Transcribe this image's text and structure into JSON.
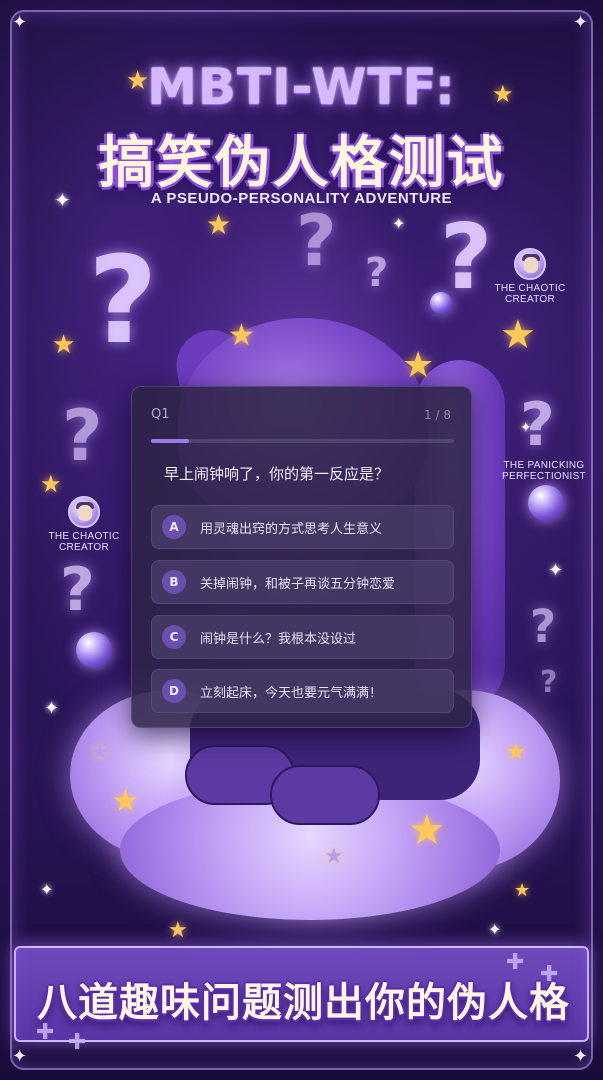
{
  "poster": {
    "title_en": "MBTI-WTF:",
    "title_cn": "搞笑伪人格测试",
    "subtitle": "A PSEUDO-PERSONALITY ADVENTURE",
    "banner": "八道趣味问题测出你的伪人格",
    "badges": [
      {
        "line1": "THE CHAOTIC",
        "line2": "CREATOR"
      },
      {
        "line1": "THE CHAOTIC",
        "line2": "CREATOR"
      },
      {
        "line1": "THE PANICKING",
        "line2": "PERFECTIONIST"
      }
    ]
  },
  "quiz": {
    "question_number": "Q1",
    "counter": "1 / 8",
    "progress": 0.125,
    "question": "早上闹钟响了，你的第一反应是？",
    "options": [
      {
        "letter": "A",
        "text": "用灵魂出窍的方式思考人生意义"
      },
      {
        "letter": "B",
        "text": "关掉闹钟，和被子再谈五分钟恋爱"
      },
      {
        "letter": "C",
        "text": "闹钟是什么？我根本没设过"
      },
      {
        "letter": "D",
        "text": "立刻起床，今天也要元气满满！"
      }
    ]
  },
  "colors": {
    "background": "#1e0f42",
    "accent": "#9b79e6",
    "card": "#2d2446",
    "star": "#ffc95a"
  },
  "icons": [
    "question-mark-icon",
    "star-icon",
    "sparkle-icon",
    "puzzle-icon",
    "avatar-icon"
  ]
}
